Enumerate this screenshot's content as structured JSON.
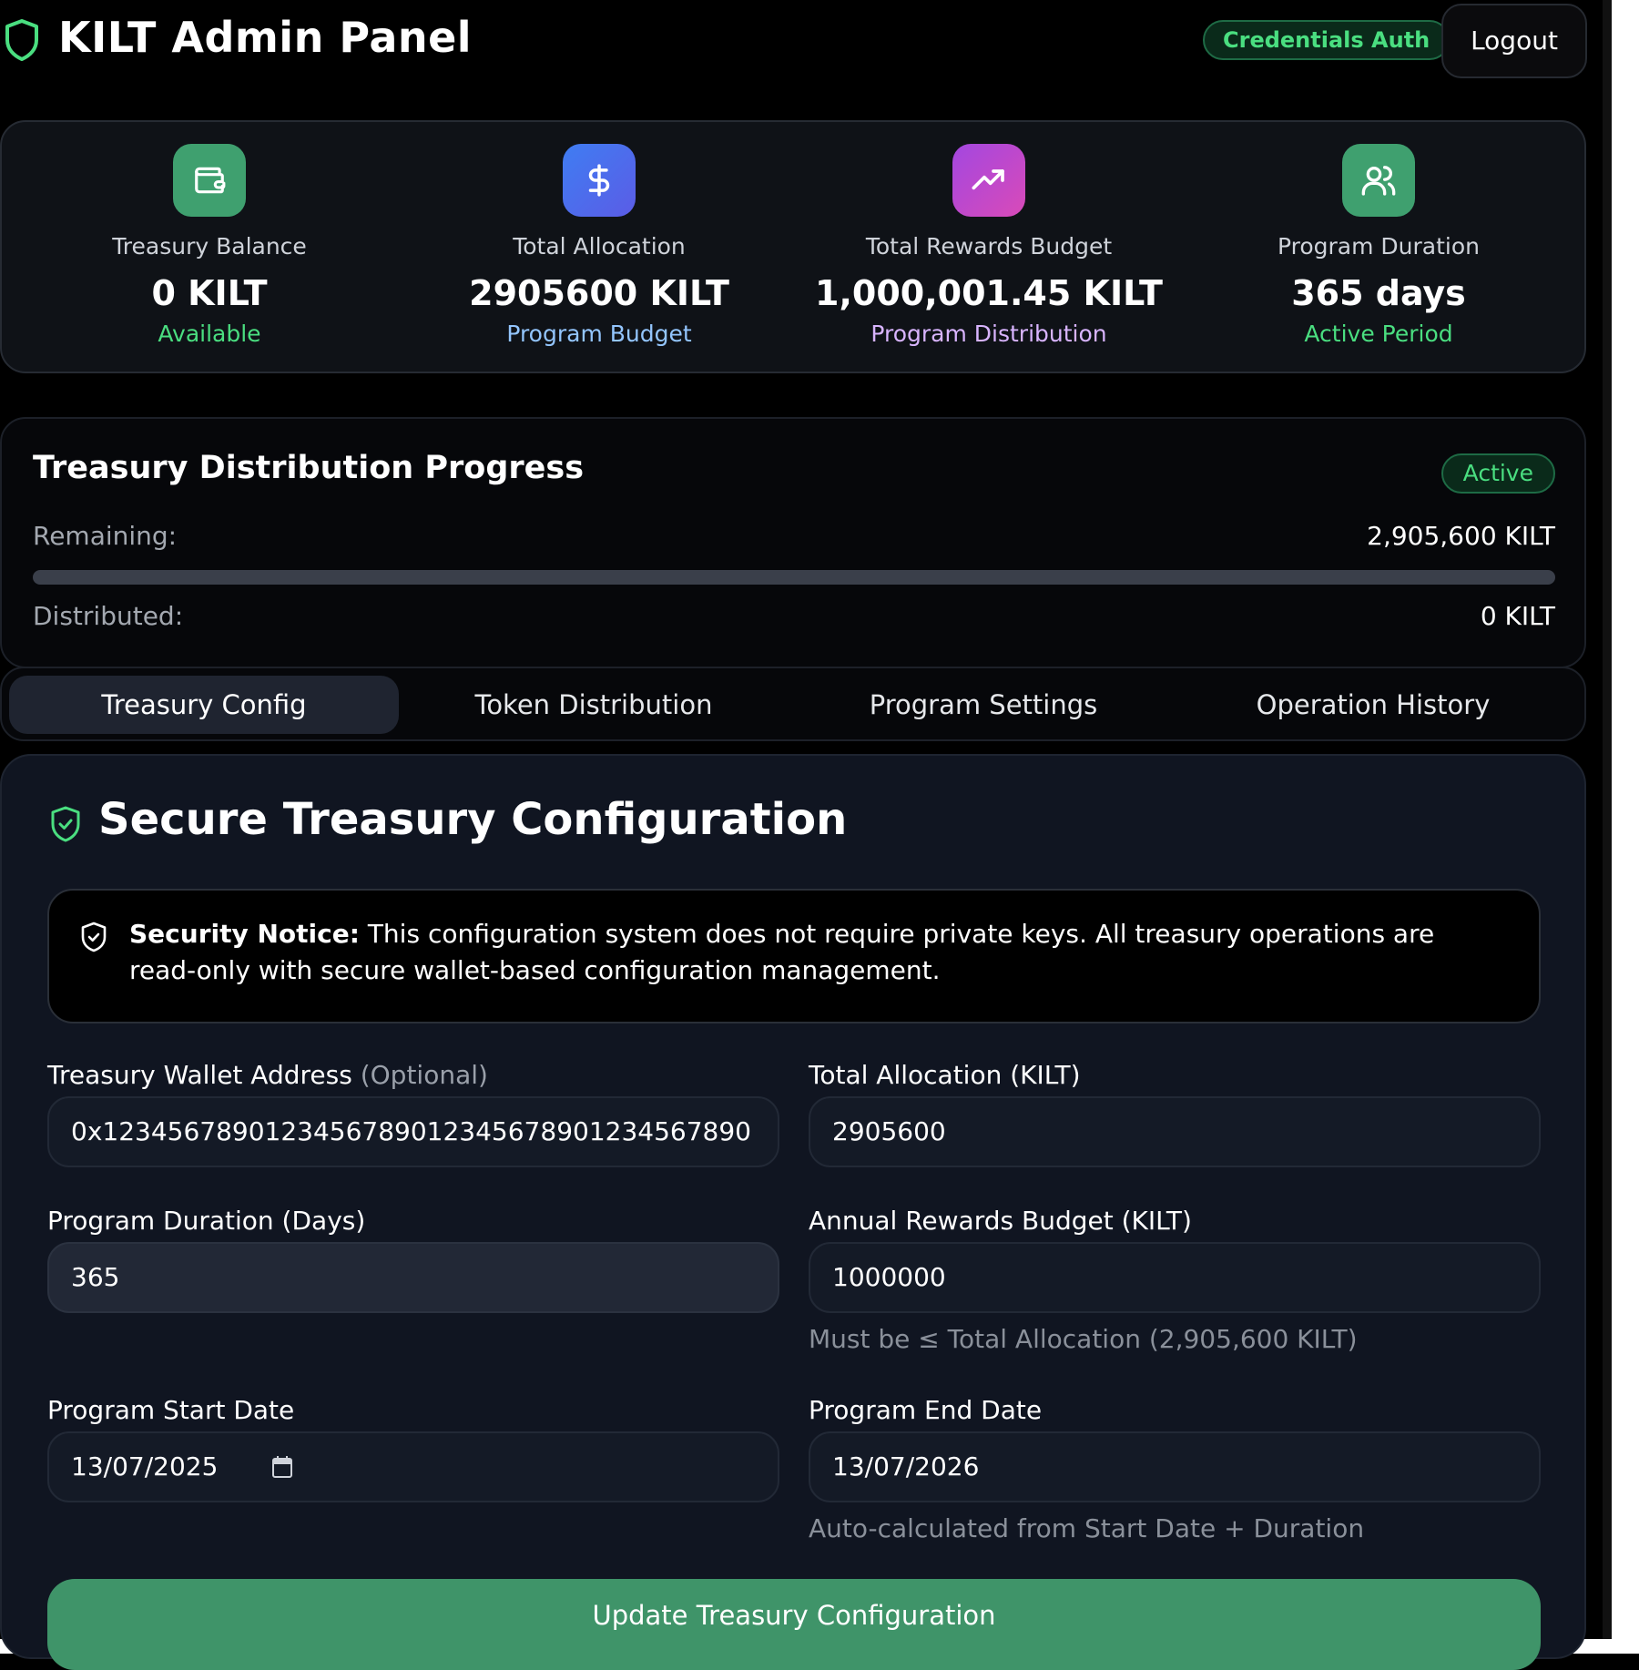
{
  "header": {
    "title": "KILT Admin Panel",
    "auth_badge": "Credentials Auth",
    "logout_label": "Logout"
  },
  "stats": [
    {
      "label": "Treasury Balance",
      "value": "0 KILT",
      "sub": "Available",
      "icon": "wallet-icon",
      "color": "#4ade80"
    },
    {
      "label": "Total Allocation",
      "value": "2905600 KILT",
      "sub": "Program Budget",
      "icon": "dollar-icon",
      "color": "#93c5fd"
    },
    {
      "label": "Total Rewards Budget",
      "value": "1,000,001.45 KILT",
      "sub": "Program Distribution",
      "icon": "trending-up-icon",
      "color": "#d8b4fe"
    },
    {
      "label": "Program Duration",
      "value": "365 days",
      "sub": "Active Period",
      "icon": "users-icon",
      "color": "#4ade80"
    }
  ],
  "progress": {
    "title": "Treasury Distribution Progress",
    "status": "Active",
    "remaining_label": "Remaining:",
    "remaining_value": "2,905,600 KILT",
    "distributed_label": "Distributed:",
    "distributed_value": "0 KILT",
    "distributed_fraction": 0
  },
  "tabs": [
    {
      "label": "Treasury Config",
      "active": true
    },
    {
      "label": "Token Distribution",
      "active": false
    },
    {
      "label": "Program Settings",
      "active": false
    },
    {
      "label": "Operation History",
      "active": false
    }
  ],
  "config": {
    "title": "Secure Treasury Configuration",
    "notice_bold": "Security Notice:",
    "notice_text": " This configuration system does not require private keys. All treasury operations are read-only with secure wallet-based configuration management.",
    "wallet_label": "Treasury Wallet Address",
    "wallet_optional": "(Optional)",
    "wallet_value": "0x1234567890123456789012345678901234567890",
    "allocation_label": "Total Allocation (KILT)",
    "allocation_value": "2905600",
    "duration_label": "Program Duration (Days)",
    "duration_value": "365",
    "rewards_label": "Annual Rewards Budget (KILT)",
    "rewards_value": "1000000",
    "rewards_hint": "Must be ≤ Total Allocation (2,905,600 KILT)",
    "start_label": "Program Start Date",
    "start_value": "13/07/2025",
    "end_label": "Program End Date",
    "end_value": "13/07/2026",
    "end_hint": "Auto-calculated from Start Date + Duration",
    "update_label": "Update Treasury Configuration"
  },
  "colors": {
    "accent_green": "#4ade80",
    "button_green": "#3f9469",
    "wallet_icon_bg": "#3fa06f",
    "dollar_icon_bg": "#4f6ef0",
    "trend_icon_bg": "#b547d6",
    "users_icon_bg": "#3fa06f"
  }
}
